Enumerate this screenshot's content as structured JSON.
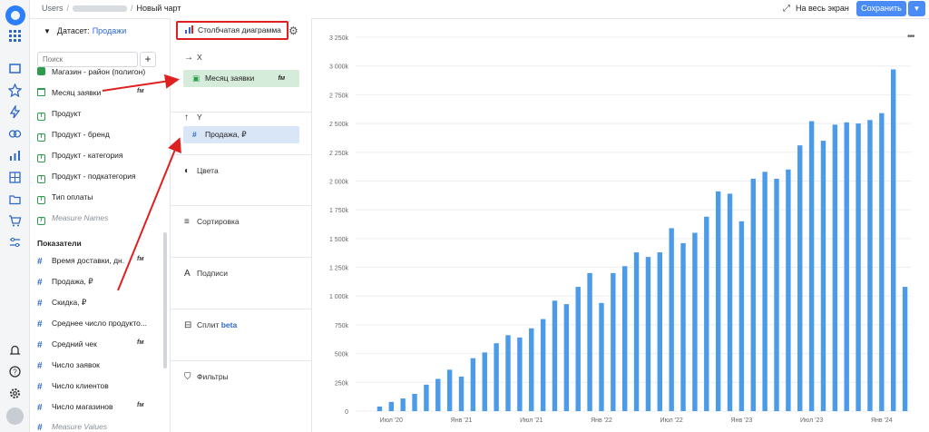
{
  "breadcrumb": {
    "root": "Users",
    "current": "Новый чарт"
  },
  "header": {
    "fullscreen_label": "На весь экран",
    "save_label": "Сохранить"
  },
  "dataset": {
    "label": "Датасет:",
    "name": "Продажи",
    "search_placeholder": "Поиск",
    "dimensions": [
      {
        "label": "Магазин - район (полигон)",
        "icon": "polygon-icon",
        "fm": ""
      },
      {
        "label": "Месяц заявки",
        "icon": "calendar-icon",
        "fm": "fм"
      },
      {
        "label": "Продукт",
        "icon": "text-icon",
        "fm": ""
      },
      {
        "label": "Продукт - бренд",
        "icon": "text-icon",
        "fm": ""
      },
      {
        "label": "Продукт - категория",
        "icon": "text-icon",
        "fm": ""
      },
      {
        "label": "Продукт - подкатегория",
        "icon": "text-icon",
        "fm": ""
      },
      {
        "label": "Тип оплаты",
        "icon": "text-icon",
        "fm": ""
      },
      {
        "label": "Measure Names",
        "icon": "text-icon",
        "fm": ""
      }
    ],
    "measures_title": "Показатели",
    "measures": [
      {
        "label": "Время доставки, дн.",
        "fm": "fм"
      },
      {
        "label": "Продажа, ₽",
        "fm": ""
      },
      {
        "label": "Скидка, ₽",
        "fm": ""
      },
      {
        "label": "Среднее число продукто...",
        "fm": ""
      },
      {
        "label": "Средний чек",
        "fm": "fм"
      },
      {
        "label": "Число заявок",
        "fm": ""
      },
      {
        "label": "Число клиентов",
        "fm": ""
      },
      {
        "label": "Число магазинов",
        "fm": "fм"
      },
      {
        "label": "Measure Values",
        "fm": ""
      }
    ]
  },
  "shelves": {
    "chart_type": "Столбчатая диаграмма",
    "x_label": "X",
    "x_field": "Месяц заявки",
    "x_field_fm": "fм",
    "y_label": "Y",
    "y_field": "Продажа, ₽",
    "colors": "Цвета",
    "sort": "Сортировка",
    "labels": "Подписи",
    "split": "Сплит",
    "split_badge": "beta",
    "filters": "Фильтры"
  },
  "colors": {
    "accent": "#4b8bf5",
    "bar": "#4c9be8",
    "highlight": "#e02020",
    "dimension": "#2e9c4c",
    "measure": "#2d68c9"
  },
  "chart_data": {
    "type": "bar",
    "ylim": [
      0,
      3250
    ],
    "y_ticks": [
      "0",
      "250k",
      "500k",
      "750k",
      "1 000k",
      "1 250k",
      "1 500k",
      "1 750k",
      "2 000k",
      "2 250k",
      "2 500k",
      "2 750k",
      "3 000k",
      "3 250k"
    ],
    "x_tick_labels": [
      "Июл '20",
      "Янв '21",
      "Июл '21",
      "Янв '22",
      "Июл '22",
      "Янв '23",
      "Июл '23",
      "Янв '24"
    ],
    "x_tick_index": [
      1,
      7,
      13,
      19,
      25,
      31,
      37,
      43
    ],
    "values": [
      40,
      80,
      110,
      150,
      230,
      280,
      360,
      300,
      460,
      510,
      590,
      660,
      640,
      720,
      800,
      960,
      930,
      1080,
      1200,
      940,
      1200,
      1260,
      1380,
      1340,
      1380,
      1590,
      1460,
      1550,
      1690,
      1910,
      1890,
      1650,
      2020,
      2080,
      2020,
      2100,
      2310,
      2520,
      2350,
      2490,
      2510,
      2500,
      2530,
      2590,
      2970,
      1080
    ]
  }
}
